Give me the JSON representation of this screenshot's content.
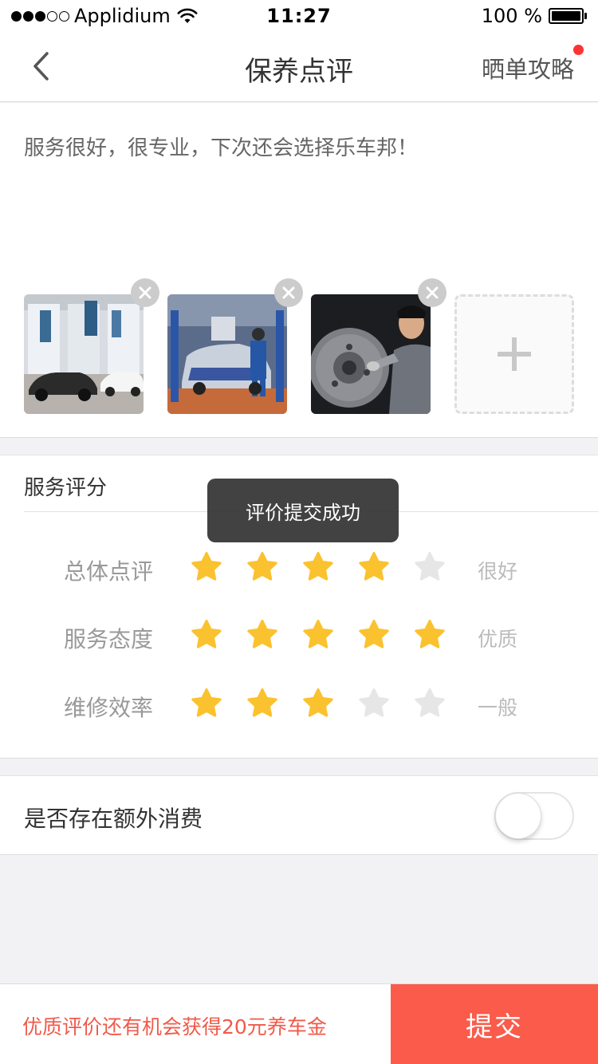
{
  "status_bar": {
    "carrier": "Applidium",
    "time": "11:27",
    "battery": "100 %",
    "signal_bars_filled": 3,
    "signal_bars_total": 5
  },
  "nav": {
    "title": "保养点评",
    "right_action": "晒单攻略",
    "right_action_has_badge": true,
    "back_icon": "chevron-left-icon"
  },
  "review": {
    "text": "服务很好，很专业，下次还会选择乐车邦！",
    "photos": [
      {
        "subject": "car showroom"
      },
      {
        "subject": "mechanic repairing car on lift"
      },
      {
        "subject": "brake disc inspection"
      }
    ],
    "add_photo_icon": "plus-icon",
    "remove_icon": "close-icon"
  },
  "rating": {
    "section_title": "服务评分",
    "rows": [
      {
        "label": "总体点评",
        "stars": 4,
        "max": 5,
        "word": "很好"
      },
      {
        "label": "服务态度",
        "stars": 5,
        "max": 5,
        "word": "优质"
      },
      {
        "label": "维修效率",
        "stars": 3,
        "max": 5,
        "word": "一般"
      }
    ]
  },
  "extra": {
    "label": "是否存在额外消费",
    "toggle_on": false
  },
  "bottom": {
    "promo": "优质评价还有机会获得20元养车金",
    "submit": "提交"
  },
  "toast": {
    "message": "评价提交成功"
  },
  "colors": {
    "accent": "#fa5b4a",
    "promo_text": "#f05a4a",
    "star_on": "#fbc22f",
    "star_off": "#e6e6e6",
    "badge": "#ff3333",
    "background": "#f2f2f5"
  }
}
